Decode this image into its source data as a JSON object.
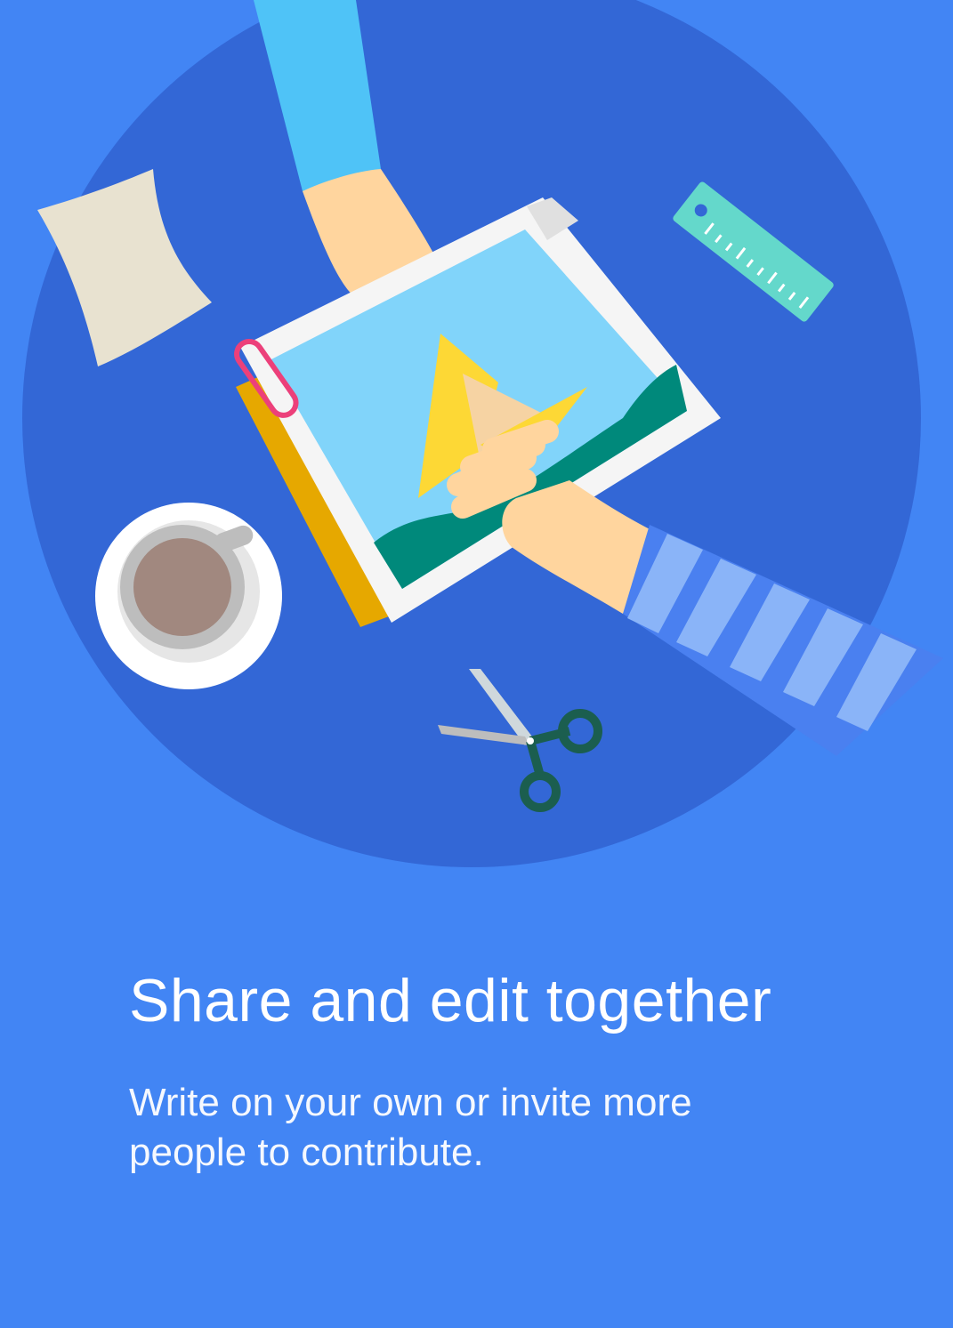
{
  "onboarding": {
    "title": "Share and edit together",
    "description": "Write on your own or invite more people to contribute."
  },
  "colors": {
    "background": "#4285f4",
    "circle": "#3367d6",
    "text": "#ffffff"
  },
  "illustration": {
    "icon": "collaboration-desk-illustration",
    "items": [
      "paper-sheet",
      "sleeve-arm",
      "photo-page",
      "paper-clip",
      "ruler",
      "coffee-cup",
      "striped-arm",
      "scissors"
    ]
  }
}
